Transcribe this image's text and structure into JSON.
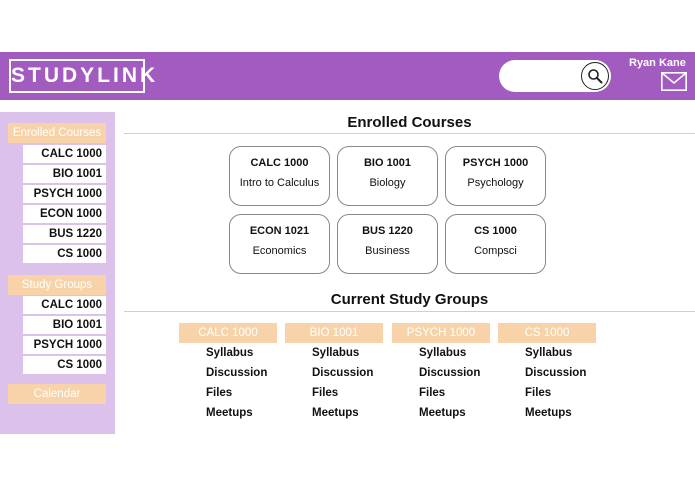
{
  "header": {
    "logo": "STUDYLINK",
    "user_name": "Ryan Kane",
    "search_value": ""
  },
  "sidebar": {
    "enrolled_heading": "Enrolled Courses",
    "enrolled_items": [
      "CALC 1000",
      "BIO 1001",
      "PSYCH 1000",
      "ECON 1000",
      "BUS 1220",
      "CS 1000"
    ],
    "groups_heading": "Study Groups",
    "group_items": [
      "CALC 1000",
      "BIO 1001",
      "PSYCH 1000",
      "CS 1000"
    ],
    "calendar_label": "Calendar"
  },
  "main": {
    "enrolled_title": "Enrolled Courses",
    "courses": [
      {
        "code": "CALC 1000",
        "name": "Intro to Calculus"
      },
      {
        "code": "BIO 1001",
        "name": "Biology"
      },
      {
        "code": "PSYCH 1000",
        "name": "Psychology"
      },
      {
        "code": "ECON 1021",
        "name": "Economics"
      },
      {
        "code": "BUS 1220",
        "name": "Business"
      },
      {
        "code": "CS 1000",
        "name": "Compsci"
      }
    ],
    "groups_title": "Current Study Groups",
    "groups": [
      {
        "name": "CALC 1000",
        "links": [
          "Syllabus",
          "Discussion",
          "Files",
          "Meetups"
        ]
      },
      {
        "name": "BIO 1001",
        "links": [
          "Syllabus",
          "Discussion",
          "Files",
          "Meetups"
        ]
      },
      {
        "name": "PSYCH 1000",
        "links": [
          "Syllabus",
          "Discussion",
          "Files",
          "Meetups"
        ]
      },
      {
        "name": "CS 1000",
        "links": [
          "Syllabus",
          "Discussion",
          "Files",
          "Meetups"
        ]
      }
    ]
  },
  "colors": {
    "header": "#a25cbf",
    "sidebar": "#dcc1ea",
    "accent_peach": "#f8d3a9"
  },
  "icons": {
    "search": "search-icon",
    "mail": "mail-icon"
  }
}
